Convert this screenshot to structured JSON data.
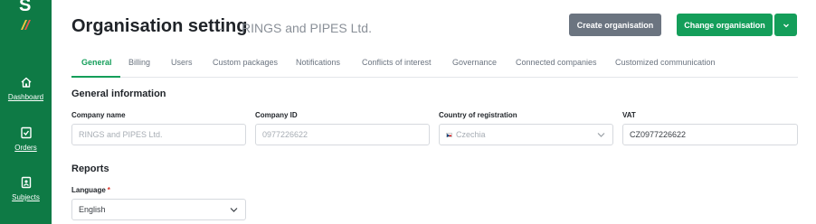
{
  "sidebar": {
    "brand_letter": "S",
    "items": [
      {
        "label": "Dashboard",
        "icon": "home-icon"
      },
      {
        "label": "Orders",
        "icon": "orders-icon"
      },
      {
        "label": "Subjects",
        "icon": "subjects-icon"
      }
    ]
  },
  "header": {
    "title": "Organisation setting",
    "separator": "-",
    "org_name": "RINGS and PIPES Ltd.",
    "create_button": "Create organisation",
    "change_button": "Change organisation",
    "dropdown_icon": "chevron-down-icon"
  },
  "tabs": [
    {
      "label": "General",
      "active": true
    },
    {
      "label": "Billing"
    },
    {
      "label": "Users"
    },
    {
      "label": "Custom packages"
    },
    {
      "label": "Notifications"
    },
    {
      "label": "Conflicts of interest"
    },
    {
      "label": "Governance"
    },
    {
      "label": "Connected companies"
    },
    {
      "label": "Customized communication"
    }
  ],
  "general": {
    "title": "General information",
    "company_name": {
      "label": "Company name",
      "value": "RINGS and PIPES Ltd."
    },
    "company_id": {
      "label": "Company ID",
      "value": "0977226622"
    },
    "country": {
      "label": "Country of registration",
      "value": "Czechia"
    },
    "vat": {
      "label": "VAT",
      "value": "CZ0977226622"
    }
  },
  "reports": {
    "title": "Reports",
    "language": {
      "label": "Language",
      "required_mark": "*",
      "value": "English"
    }
  },
  "colors": {
    "sidebar": "#0e7a45",
    "primary": "#149e5a",
    "secondary_button": "#6b7480"
  }
}
